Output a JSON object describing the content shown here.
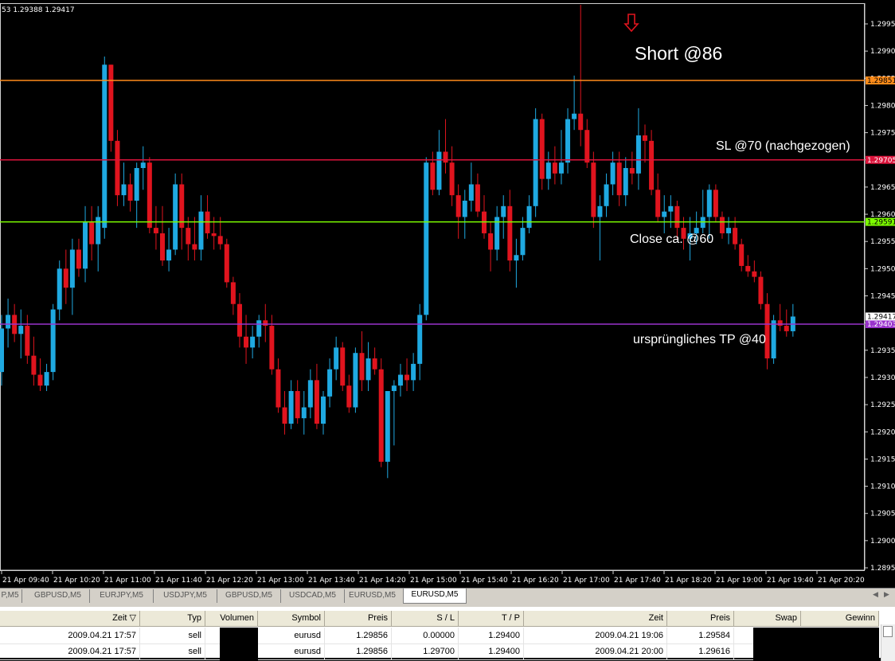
{
  "chart": {
    "ohlc_text": "53 1.29388 1.29417",
    "price_axis_ticks": [
      "1.29955",
      "1.29905",
      "1.29855",
      "1.29805",
      "1.29755",
      "1.29705",
      "1.29655",
      "1.29605",
      "1.29555",
      "1.29505",
      "1.29455",
      "1.29405",
      "1.29355",
      "1.29305",
      "1.29255",
      "1.29205",
      "1.29155",
      "1.29105",
      "1.29055",
      "1.29005",
      "1.28955"
    ],
    "time_axis_labels": [
      "21 Apr 09:40",
      "21 Apr 10:20",
      "21 Apr 11:00",
      "21 Apr 11:40",
      "21 Apr 12:20",
      "21 Apr 13:00",
      "21 Apr 13:40",
      "21 Apr 14:20",
      "21 Apr 15:00",
      "21 Apr 15:40",
      "21 Apr 16:20",
      "21 Apr 17:00",
      "21 Apr 17:40",
      "21 Apr 18:20",
      "21 Apr 19:00",
      "21 Apr 19:40",
      "21 Apr 20:20"
    ],
    "levels": [
      {
        "price": 1.29851,
        "label": "1.29851",
        "color": "#ff8c1a"
      },
      {
        "price": 1.29705,
        "label": "1.29705",
        "color": "#dc143c"
      },
      {
        "price": 1.29591,
        "label": "1.29591",
        "color": "#7cfc00"
      },
      {
        "price": 1.29403,
        "label": "1.29403",
        "color": "#9932cc"
      }
    ],
    "current_price": "1.29417",
    "annotations": {
      "short": "Short @86",
      "sl": "SL @70 (nachgezogen)",
      "close": "Close ca. @60",
      "tp": "ursprüngliches TP @40"
    },
    "colors": {
      "bull": "#1fa9e1",
      "bear": "#e0141e",
      "background": "#000000"
    }
  },
  "chart_data": {
    "type": "candlestick",
    "symbol": "EURUSD",
    "timeframe": "M5",
    "ylim": [
      1.2894,
      1.3
    ],
    "candles_ohlc": [
      [
        1.29315,
        1.2942,
        1.2929,
        1.29395
      ],
      [
        1.29395,
        1.2945,
        1.2936,
        1.2942
      ],
      [
        1.2942,
        1.2944,
        1.2937,
        1.29385
      ],
      [
        1.29385,
        1.2943,
        1.2934,
        1.294
      ],
      [
        1.294,
        1.2942,
        1.2933,
        1.29345
      ],
      [
        1.29345,
        1.2938,
        1.2929,
        1.2931
      ],
      [
        1.2931,
        1.2934,
        1.2928,
        1.2929
      ],
      [
        1.2929,
        1.2933,
        1.2928,
        1.29315
      ],
      [
        1.29315,
        1.2944,
        1.293,
        1.2943
      ],
      [
        1.2943,
        1.2952,
        1.2941,
        1.29505
      ],
      [
        1.29505,
        1.2954,
        1.2944,
        1.2947
      ],
      [
        1.2947,
        1.2956,
        1.2942,
        1.2954
      ],
      [
        1.2954,
        1.2956,
        1.2949,
        1.29505
      ],
      [
        1.29505,
        1.2962,
        1.2948,
        1.2959
      ],
      [
        1.2959,
        1.2962,
        1.2952,
        1.2955
      ],
      [
        1.2955,
        1.2962,
        1.295,
        1.296
      ],
      [
        1.2958,
        1.29895,
        1.2956,
        1.2988
      ],
      [
        1.2988,
        1.2988,
        1.2972,
        1.2974
      ],
      [
        1.2974,
        1.2976,
        1.2962,
        1.2964
      ],
      [
        1.2964,
        1.297,
        1.2962,
        1.2966
      ],
      [
        1.2966,
        1.2968,
        1.2961,
        1.2963
      ],
      [
        1.2963,
        1.297,
        1.2958,
        1.2969
      ],
      [
        1.2969,
        1.2973,
        1.2965,
        1.297
      ],
      [
        1.297,
        1.2971,
        1.2957,
        1.2958
      ],
      [
        1.2958,
        1.2962,
        1.2954,
        1.2957
      ],
      [
        1.2957,
        1.2962,
        1.2951,
        1.2952
      ],
      [
        1.2952,
        1.2958,
        1.295,
        1.2954
      ],
      [
        1.2954,
        1.2968,
        1.2953,
        1.2966
      ],
      [
        1.2966,
        1.2968,
        1.2954,
        1.2958
      ],
      [
        1.2958,
        1.296,
        1.2952,
        1.2955
      ],
      [
        1.2955,
        1.296,
        1.2952,
        1.2954
      ],
      [
        1.2954,
        1.2964,
        1.2952,
        1.2961
      ],
      [
        1.2961,
        1.2964,
        1.2956,
        1.2957
      ],
      [
        1.2957,
        1.296,
        1.2954,
        1.29565
      ],
      [
        1.29565,
        1.296,
        1.2954,
        1.2955
      ],
      [
        1.2955,
        1.2956,
        1.2947,
        1.2948
      ],
      [
        1.2948,
        1.2949,
        1.2942,
        1.2944
      ],
      [
        1.2944,
        1.2946,
        1.2936,
        1.2938
      ],
      [
        1.2938,
        1.2942,
        1.2933,
        1.2936
      ],
      [
        1.2936,
        1.294,
        1.2934,
        1.2938
      ],
      [
        1.2938,
        1.2942,
        1.2936,
        1.2941
      ],
      [
        1.2941,
        1.2944,
        1.2937,
        1.294
      ],
      [
        1.294,
        1.2942,
        1.2931,
        1.2932
      ],
      [
        1.2932,
        1.2934,
        1.2924,
        1.2925
      ],
      [
        1.2925,
        1.2928,
        1.292,
        1.2922
      ],
      [
        1.2922,
        1.293,
        1.2921,
        1.2928
      ],
      [
        1.2928,
        1.293,
        1.2922,
        1.2923
      ],
      [
        1.2923,
        1.2928,
        1.292,
        1.2925
      ],
      [
        1.2925,
        1.2932,
        1.2923,
        1.293
      ],
      [
        1.293,
        1.2933,
        1.2921,
        1.2922
      ],
      [
        1.2922,
        1.2928,
        1.292,
        1.2927
      ],
      [
        1.2927,
        1.2934,
        1.2925,
        1.2932
      ],
      [
        1.2932,
        1.2938,
        1.293,
        1.2936
      ],
      [
        1.2936,
        1.2937,
        1.2928,
        1.2929
      ],
      [
        1.2929,
        1.2931,
        1.2924,
        1.2925
      ],
      [
        1.2925,
        1.2936,
        1.2924,
        1.2935
      ],
      [
        1.2935,
        1.2939,
        1.2928,
        1.293
      ],
      [
        1.293,
        1.2937,
        1.2928,
        1.2934
      ],
      [
        1.2934,
        1.2936,
        1.2931,
        1.2932
      ],
      [
        1.2932,
        1.2934,
        1.2914,
        1.2915
      ],
      [
        1.2915,
        1.2926,
        1.2912,
        1.2928
      ],
      [
        1.2928,
        1.293,
        1.2918,
        1.2929
      ],
      [
        1.2929,
        1.2933,
        1.2927,
        1.2931
      ],
      [
        1.2931,
        1.2934,
        1.2928,
        1.293
      ],
      [
        1.293,
        1.2935,
        1.2928,
        1.2933
      ],
      [
        1.2933,
        1.2944,
        1.293,
        1.2942
      ],
      [
        1.2942,
        1.2971,
        1.2941,
        1.297
      ],
      [
        1.297,
        1.2972,
        1.2964,
        1.2965
      ],
      [
        1.2965,
        1.2976,
        1.2964,
        1.2972
      ],
      [
        1.2972,
        1.2978,
        1.2968,
        1.297
      ],
      [
        1.297,
        1.2973,
        1.2962,
        1.2964
      ],
      [
        1.2964,
        1.2966,
        1.2956,
        1.296
      ],
      [
        1.296,
        1.2965,
        1.2956,
        1.2963
      ],
      [
        1.2963,
        1.297,
        1.2961,
        1.2966
      ],
      [
        1.2966,
        1.2968,
        1.296,
        1.2961
      ],
      [
        1.2961,
        1.2964,
        1.2956,
        1.2957
      ],
      [
        1.2957,
        1.2959,
        1.295,
        1.2954
      ],
      [
        1.2954,
        1.2962,
        1.2952,
        1.296
      ],
      [
        1.296,
        1.2964,
        1.2956,
        1.2962
      ],
      [
        1.2962,
        1.2965,
        1.295,
        1.2952
      ],
      [
        1.2952,
        1.2956,
        1.2947,
        1.2953
      ],
      [
        1.2953,
        1.296,
        1.2952,
        1.2958
      ],
      [
        1.2958,
        1.2964,
        1.2957,
        1.2962
      ],
      [
        1.2962,
        1.298,
        1.296,
        1.2978
      ],
      [
        1.2978,
        1.2979,
        1.2965,
        1.2967
      ],
      [
        1.2967,
        1.2972,
        1.2965,
        1.297
      ],
      [
        1.297,
        1.2973,
        1.2966,
        1.2968
      ],
      [
        1.2968,
        1.2976,
        1.2966,
        1.297
      ],
      [
        1.297,
        1.298,
        1.2968,
        1.2978
      ],
      [
        1.2978,
        1.2986,
        1.2976,
        1.2979
      ],
      [
        1.2979,
        1.2999,
        1.2973,
        1.2976
      ],
      [
        1.2976,
        1.2978,
        1.2969,
        1.297
      ],
      [
        1.297,
        1.2972,
        1.2958,
        1.296
      ],
      [
        1.296,
        1.2964,
        1.2952,
        1.2962
      ],
      [
        1.2962,
        1.2968,
        1.296,
        1.2966
      ],
      [
        1.2966,
        1.2972,
        1.2964,
        1.297
      ],
      [
        1.297,
        1.2972,
        1.2962,
        1.2964
      ],
      [
        1.2964,
        1.2971,
        1.2962,
        1.2969
      ],
      [
        1.2969,
        1.2972,
        1.2966,
        1.2968
      ],
      [
        1.2968,
        1.298,
        1.2965,
        1.2975
      ],
      [
        1.2975,
        1.2977,
        1.297,
        1.2974
      ],
      [
        1.2974,
        1.2976,
        1.2964,
        1.2965
      ],
      [
        1.2965,
        1.2968,
        1.2959,
        1.296
      ],
      [
        1.296,
        1.2964,
        1.2957,
        1.2961
      ],
      [
        1.2961,
        1.2964,
        1.2958,
        1.2962
      ],
      [
        1.2962,
        1.2963,
        1.2956,
        1.2958
      ],
      [
        1.2958,
        1.296,
        1.2954,
        1.2956
      ],
      [
        1.2956,
        1.296,
        1.2952,
        1.2957
      ],
      [
        1.2957,
        1.2961,
        1.2955,
        1.2958
      ],
      [
        1.2958,
        1.2965,
        1.2957,
        1.296
      ],
      [
        1.296,
        1.2966,
        1.2956,
        1.2965
      ],
      [
        1.2965,
        1.2966,
        1.2959,
        1.296
      ],
      [
        1.296,
        1.2961,
        1.2956,
        1.2957
      ],
      [
        1.2957,
        1.296,
        1.2955,
        1.2958
      ],
      [
        1.2958,
        1.296,
        1.2954,
        1.2955
      ],
      [
        1.2955,
        1.2956,
        1.295,
        1.2951
      ],
      [
        1.2951,
        1.2953,
        1.2949,
        1.295
      ],
      [
        1.295,
        1.2952,
        1.2948,
        1.2949
      ],
      [
        1.2949,
        1.295,
        1.2943,
        1.2944
      ],
      [
        1.2944,
        1.2946,
        1.2932,
        1.2934
      ],
      [
        1.2934,
        1.2942,
        1.2933,
        1.2941
      ],
      [
        1.2941,
        1.2944,
        1.2939,
        1.294
      ],
      [
        1.294,
        1.2943,
        1.2938,
        1.2939
      ],
      [
        1.2939,
        1.2944,
        1.2938,
        1.29417
      ]
    ]
  },
  "tabs": {
    "items": [
      "P,M5",
      "GBPUSD,M5",
      "EURJPY,M5",
      "USDJPY,M5",
      "GBPUSD,M5",
      "USDCAD,M5",
      "EURUSD,M5",
      "EURUSD,M5"
    ],
    "active_index": 7
  },
  "terminal": {
    "headers": [
      "Zeit",
      "Typ",
      "Volumen",
      "Symbol",
      "Preis",
      "S / L",
      "T / P",
      "Zeit",
      "Preis",
      "Swap",
      "Gewinn"
    ],
    "rows": [
      [
        "2009.04.21 17:57",
        "sell",
        "",
        "eurusd",
        "1.29856",
        "0.00000",
        "1.29400",
        "2009.04.21 19:06",
        "1.29584",
        "",
        ""
      ],
      [
        "2009.04.21 17:57",
        "sell",
        "",
        "eurusd",
        "1.29856",
        "1.29700",
        "1.29400",
        "2009.04.21 20:00",
        "1.29616",
        "",
        ""
      ]
    ]
  }
}
